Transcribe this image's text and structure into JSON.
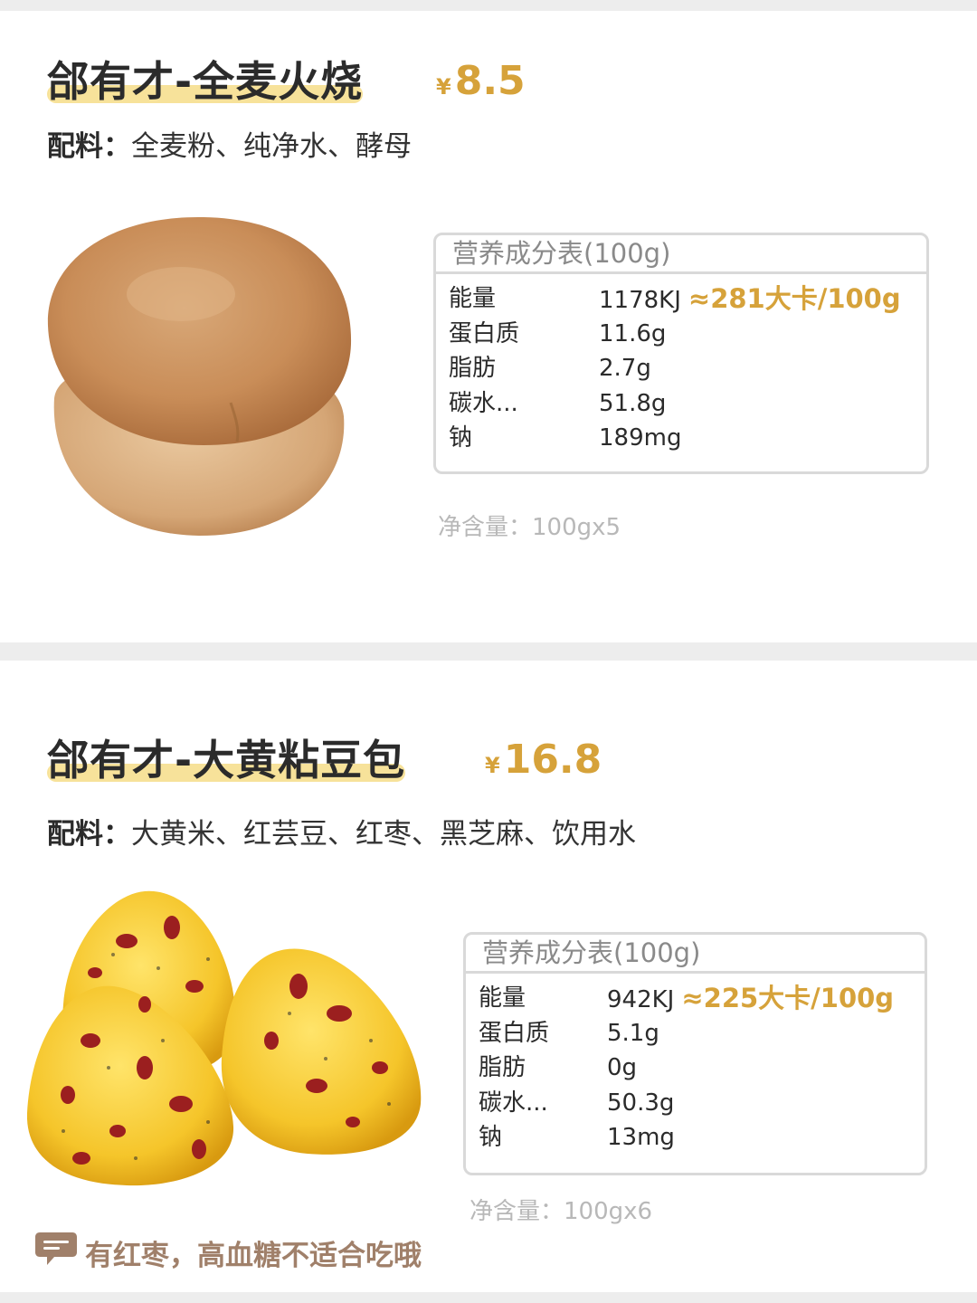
{
  "products": [
    {
      "title": "郃有才-全麦火烧",
      "price_symbol": "¥",
      "price": "8.5",
      "ingredients_label": "配料：",
      "ingredients": "全麦粉、纯净水、酵母",
      "nutrition_header": "营养成分表(100g)",
      "nutrition": [
        {
          "name": "能量",
          "value": "1178KJ",
          "extra": "≈281大卡/100g"
        },
        {
          "name": "蛋白质",
          "value": "11.6g"
        },
        {
          "name": "脂肪",
          "value": "2.7g"
        },
        {
          "name": "碳水...",
          "value": "51.8g"
        },
        {
          "name": "钠",
          "value": "189mg"
        }
      ],
      "net_weight": "净含量：100gx5"
    },
    {
      "title": "郃有才-大黄粘豆包",
      "price_symbol": "¥",
      "price": "16.8",
      "ingredients_label": "配料：",
      "ingredients": "大黄米、红芸豆、红枣、黑芝麻、饮用水",
      "nutrition_header": "营养成分表(100g)",
      "nutrition": [
        {
          "name": "能量",
          "value": "942KJ",
          "extra": "≈225大卡/100g"
        },
        {
          "name": "蛋白质",
          "value": "5.1g"
        },
        {
          "name": "脂肪",
          "value": "0g"
        },
        {
          "name": "碳水...",
          "value": "50.3g"
        },
        {
          "name": "钠",
          "value": "13mg"
        }
      ],
      "net_weight": "净含量：100gx6",
      "note": "有红枣，高血糖不适合吃哦"
    }
  ],
  "colors": {
    "accent": "#d6a23a",
    "highlight": "#f7e29a",
    "note": "#a0806a"
  }
}
